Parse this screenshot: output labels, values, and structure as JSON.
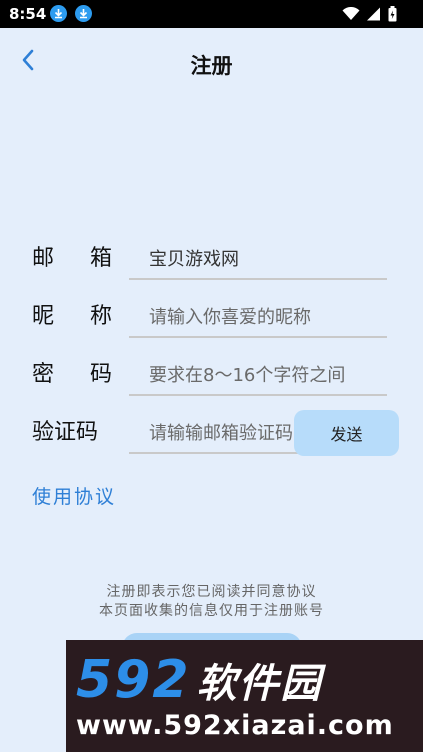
{
  "status_bar": {
    "time": "8:54",
    "icons": [
      "download-icon",
      "download-icon",
      "wifi-icon",
      "signal-icon",
      "battery-icon"
    ]
  },
  "header": {
    "title": "注册",
    "back_icon": "chevron-left-icon"
  },
  "form": {
    "email": {
      "label_chars": [
        "邮",
        "箱"
      ],
      "value": "宝贝游戏网"
    },
    "nickname": {
      "label_chars": [
        "昵",
        "称"
      ],
      "placeholder": "请输入你喜爱的昵称"
    },
    "password": {
      "label_chars": [
        "密",
        "码"
      ],
      "placeholder": "要求在8～16个字符之间"
    },
    "code": {
      "label": "验证码",
      "placeholder": "请输输邮箱验证码",
      "send_label": "发送"
    }
  },
  "agreement_link": "使用协议",
  "notice": {
    "line1": "注册即表示您已阅读并同意协议",
    "line2": "本页面收集的信息仅用于注册账号"
  },
  "watermark": {
    "digits": "592",
    "brand": "软件园",
    "url": "www.592xiazai.com"
  },
  "colors": {
    "background": "#e4eefb",
    "accent": "#2e7fd6",
    "button": "#b7dcfa"
  }
}
